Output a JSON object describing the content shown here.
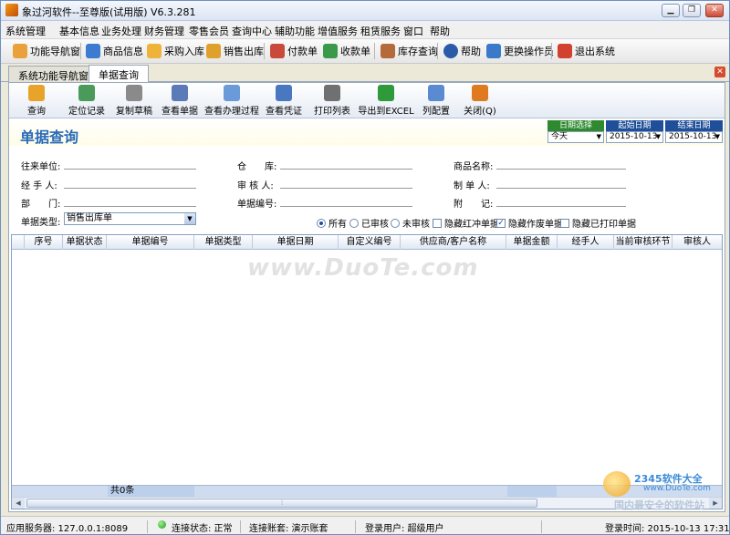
{
  "window": {
    "title": "象过河软件--至尊版(试用版) V6.3.281"
  },
  "menu": [
    "系统管理",
    "基本信息",
    "业务处理",
    "财务管理",
    "零售会员",
    "查询中心",
    "辅助功能",
    "增值服务",
    "租赁服务",
    "窗口",
    "帮助"
  ],
  "toolbar": [
    {
      "label": "功能导航窗",
      "icon": "home-icon",
      "color": "#e9a23b"
    },
    {
      "label": "商品信息",
      "icon": "grid-icon",
      "color": "#3c7bd0"
    },
    {
      "label": "采购入库",
      "icon": "inbound-arrow-icon",
      "color": "#f0b33a"
    },
    {
      "label": "销售出库",
      "icon": "outbound-arrow-icon",
      "color": "#e0a02c"
    },
    {
      "label": "付款单",
      "icon": "payment-icon",
      "color": "#c94a3a"
    },
    {
      "label": "收款单",
      "icon": "receipt-icon",
      "color": "#3a9a4a"
    },
    {
      "label": "库存查询",
      "icon": "inventory-icon",
      "color": "#b46a3a"
    },
    {
      "label": "帮助",
      "icon": "help-icon",
      "color": "#2b5aa8"
    },
    {
      "label": "更换操作员",
      "icon": "users-icon",
      "color": "#3a7ac8"
    },
    {
      "label": "退出系统",
      "icon": "power-icon",
      "color": "#d24030"
    }
  ],
  "tabs": [
    {
      "label": "系统功能导航窗",
      "active": false
    },
    {
      "label": "单据查询",
      "active": true
    }
  ],
  "buttons": [
    {
      "label": "查询",
      "icon": "magnifier-icon",
      "color": "#e8a42a"
    },
    {
      "label": "定位记录",
      "icon": "locate-icon",
      "color": "#4a9a5a"
    },
    {
      "label": "复制草稿",
      "icon": "copy-icon",
      "color": "#8a8a8a"
    },
    {
      "label": "查看单据",
      "icon": "view-document-icon",
      "color": "#5a7ab8"
    },
    {
      "label": "查看办理过程",
      "icon": "process-icon",
      "color": "#6a9ad8"
    },
    {
      "label": "查看凭证",
      "icon": "voucher-icon",
      "color": "#4a78c0"
    },
    {
      "label": "打印列表",
      "icon": "printer-icon",
      "color": "#707070"
    },
    {
      "label": "导出到EXCEL",
      "icon": "excel-icon",
      "color": "#2f9a3a"
    },
    {
      "label": "列配置",
      "icon": "checklist-icon",
      "color": "#5a8ad0"
    },
    {
      "label": "关闭(Q)",
      "icon": "close-icon",
      "color": "#e07a20"
    }
  ],
  "page": {
    "title": "单据查询"
  },
  "dates": {
    "select_header": "日期选择",
    "select_value": "今天",
    "start_header": "起始日期",
    "start_value": "2015-10-13",
    "end_header": "结束日期",
    "end_value": "2015-10-13"
  },
  "filters": {
    "partner": "往来单位:",
    "warehouse": "仓　　库:",
    "product": "商品名称:",
    "handler": "经 手 人:",
    "auditor": "审 核 人:",
    "maker": "制 单 人:",
    "department": "部　　门:",
    "doc_no": "单据编号:",
    "note": "附　　记:",
    "doc_type_label": "单据类型:",
    "doc_type_value": "销售出库单"
  },
  "options": {
    "all": "所有",
    "audited": "已审核",
    "unaudited": "未审核",
    "hide_red": "隐藏红冲单据",
    "hide_void": "隐藏作废单据",
    "hide_printed": "隐藏已打印单据"
  },
  "grid": {
    "columns": [
      "序号",
      "单据状态",
      "单据编号",
      "单据类型",
      "单据日期",
      "自定义编号",
      "供应商/客户名称",
      "单据金额",
      "经手人",
      "当前审核环节",
      "审核人"
    ],
    "count_text": "共0条"
  },
  "watermark": "www.DuoTe.com",
  "corner_logo": {
    "line1": "2345软件大全",
    "line2": "www.DuoTe.com",
    "line3": "国内最安全的软件站"
  },
  "status": {
    "server": "应用服务器: 127.0.0.1:8089",
    "conn": "连接状态: 正常",
    "account": "连接账套: 演示账套",
    "user": "登录用户: 超级用户",
    "time": "登录时间: 2015-10-13 17:31"
  }
}
